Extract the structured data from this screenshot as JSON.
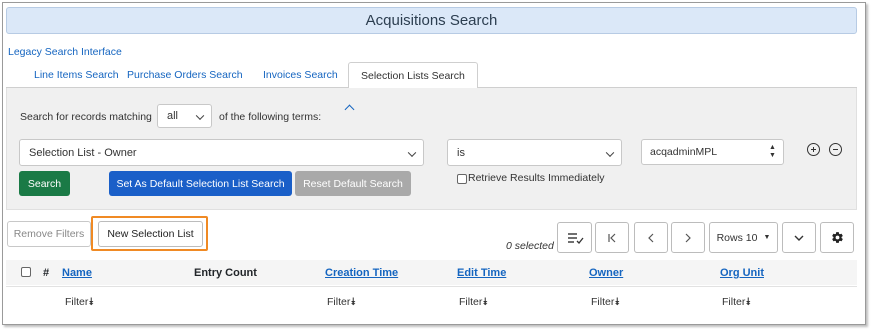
{
  "header": {
    "title": "Acquisitions Search"
  },
  "legacy_link": "Legacy Search Interface",
  "tabs": [
    {
      "label": "Line Items Search",
      "active": false
    },
    {
      "label": "Purchase Orders Search",
      "active": false
    },
    {
      "label": "Invoices Search",
      "active": false
    },
    {
      "label": "Selection Lists Search",
      "active": true
    }
  ],
  "search": {
    "prefix_label": "Search for records matching",
    "match_value": "all",
    "suffix_label": "of the following terms:",
    "field_value": "Selection List - Owner",
    "operator_value": "is",
    "term_value": "acqadminMPL",
    "search_label": "Search",
    "set_default_label": "Set As Default Selection List Search",
    "reset_default_label": "Reset Default Search",
    "retrieve_label": "Retrieve Results Immediately",
    "retrieve_checked": false
  },
  "toolbar": {
    "remove_filters_label": "Remove Filters",
    "new_selection_list_label": "New Selection List",
    "selected_count": "0 selected",
    "rows_label": "Rows 10"
  },
  "grid": {
    "hash_label": "#",
    "columns": [
      "Name",
      "Entry Count",
      "Creation Time",
      "Edit Time",
      "Owner",
      "Org Unit"
    ],
    "filter_label": "Filter"
  },
  "colors": {
    "title_bg": "#dbe8f8",
    "green": "#1a7a46",
    "blue": "#1a5fc8",
    "gray": "#a9a9a9",
    "link": "#1565c0",
    "highlight": "#f08a24"
  }
}
